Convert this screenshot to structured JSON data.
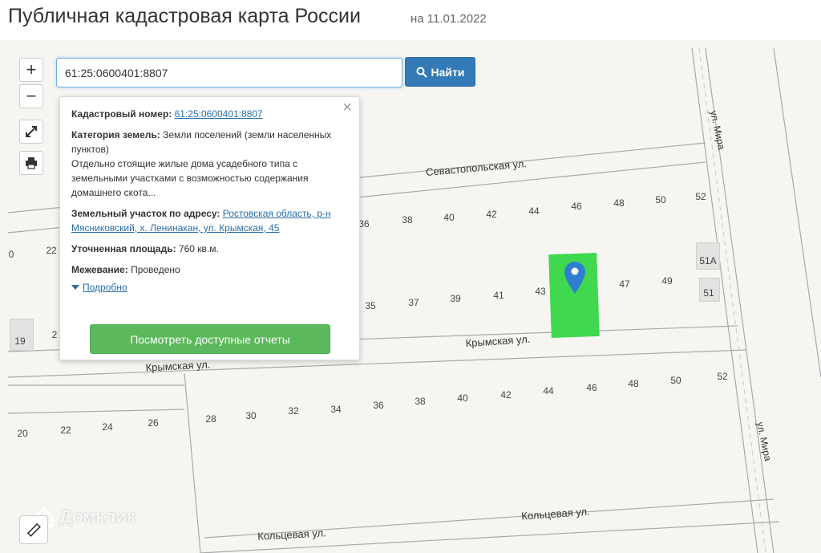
{
  "header": {
    "title": "Публичная кадастровая карта России",
    "date": "на 11.01.2022"
  },
  "controls": {
    "zoom_in": "+",
    "zoom_out": "−"
  },
  "search": {
    "value": "61:25:0600401:8807",
    "button_label": "Найти"
  },
  "popup": {
    "cadastral_number_label": "Кадастровый номер:",
    "cadastral_number": "61:25:0600401:8807",
    "category_label": "Категория земель:",
    "category_value": "Земли поселений (земли населенных пунктов)",
    "permitted_use": "Отдельно стоящие жилые дома усадебного типа с земельными участками с возможностью содержания домашнего скота...",
    "address_label": "Земельный участок по адресу:",
    "address_value": "Ростовская область, р-н Мясниковский, х. Ленинакан, ул. Крымская, 45",
    "area_label": "Уточненная площадь:",
    "area_value": "760 кв.м.",
    "survey_label": "Межевание:",
    "survey_value": "Проведено",
    "more_link": "Подробно",
    "reports_button": "Посмотреть доступные отчеты"
  },
  "streets": {
    "sevastopolskaya": "Севастопольская ул.",
    "krymskaya_right": "Крымская ул.",
    "krymskaya_left": "Крымская ул.",
    "koltsevaya_right": "Кольцевая ул.",
    "koltsevaya_left": "Кольцевая ул.",
    "mira_top": "ул. Мира",
    "mira_bottom": "ул. Мира"
  },
  "house_numbers": {
    "row1": [
      "36",
      "38",
      "40",
      "42",
      "44",
      "46",
      "48",
      "50",
      "52"
    ],
    "row1_left": [
      "0",
      "22"
    ],
    "row2": [
      "35",
      "37",
      "39",
      "41",
      "43",
      "47",
      "49"
    ],
    "row2_right": [
      "51А",
      "51"
    ],
    "row2_left": [
      "19",
      "2"
    ],
    "row3": [
      "20",
      "22",
      "24",
      "26",
      "28",
      "30",
      "32",
      "34",
      "36",
      "38",
      "40",
      "42",
      "44",
      "46",
      "48",
      "50",
      "52"
    ]
  },
  "watermark": "Домклик",
  "colors": {
    "parcel": "#3fd84f",
    "search_button": "#337ab7",
    "reports_button": "#5cb85c",
    "link": "#2a6ea8"
  }
}
